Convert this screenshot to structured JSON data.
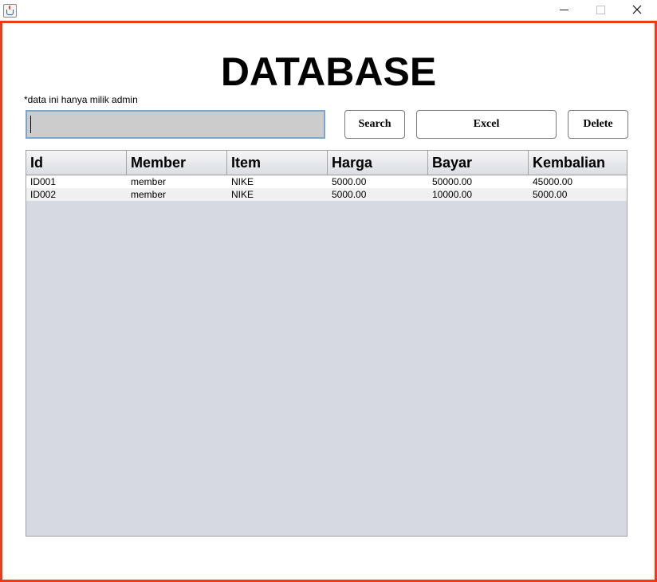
{
  "window": {
    "icon": "java-cup-icon",
    "controls": [
      "minimize-icon",
      "maximize-icon",
      "close-icon"
    ]
  },
  "header": {
    "title": "DATABASE",
    "note": "*data ini hanya milik admin"
  },
  "search": {
    "value": "",
    "placeholder": ""
  },
  "buttons": {
    "search": "Search",
    "excel": "Excel",
    "delete": "Delete"
  },
  "table": {
    "columns": [
      "Id",
      "Member",
      "Item",
      "Harga",
      "Bayar",
      "Kembalian"
    ],
    "rows": [
      [
        "ID001",
        "member",
        "NIKE",
        "5000.00",
        "50000.00",
        "45000.00"
      ],
      [
        "ID002",
        "member",
        "NIKE",
        "5000.00",
        "10000.00",
        "5000.00"
      ]
    ]
  },
  "colors": {
    "frame_border": "#f03a17",
    "input_bg": "#cccccc",
    "table_bg": "#d6d9e1"
  }
}
